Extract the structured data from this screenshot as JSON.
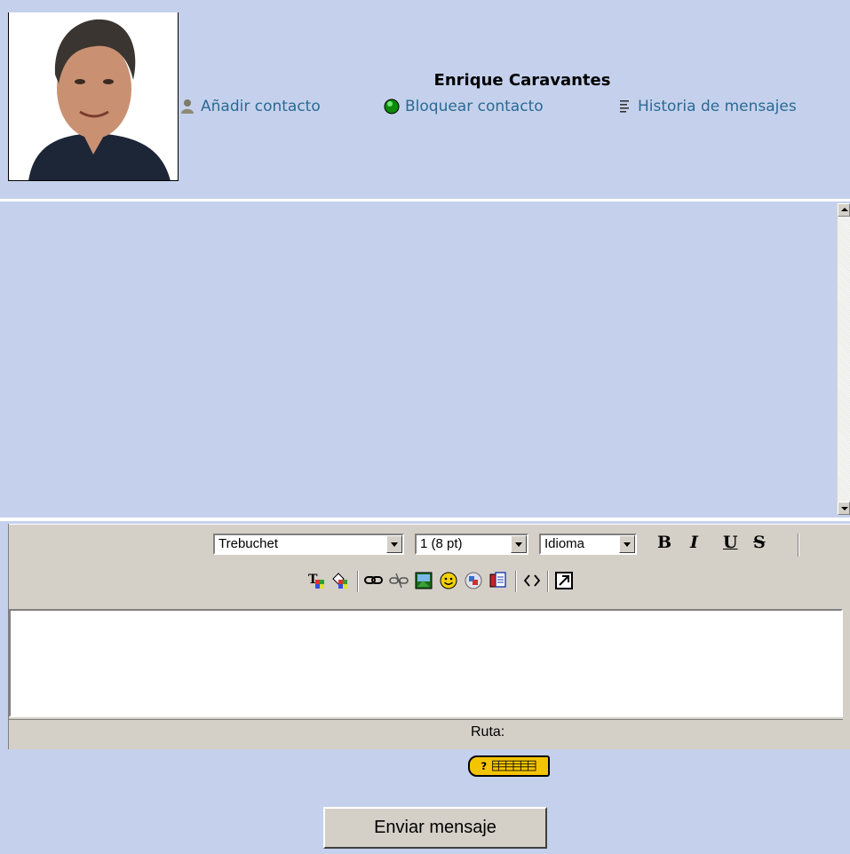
{
  "contact": {
    "name": "Enrique Caravantes",
    "actions": [
      {
        "label": "Añadir contacto",
        "icon": "person-icon"
      },
      {
        "label": "Bloquear contacto",
        "icon": "green-status-icon"
      },
      {
        "label": "Historia de mensajes",
        "icon": "history-list-icon"
      }
    ]
  },
  "editor": {
    "font_select": "Trebuchet",
    "size_select": "1 (8 pt)",
    "language_select": "Idioma",
    "format_buttons": [
      "B",
      "I",
      "U",
      "S"
    ],
    "path_label": "Ruta:"
  },
  "send_button": "Enviar mensaje",
  "colors": {
    "background": "#c5d1ec",
    "link": "#2a6a94",
    "toolbar": "#d4d0c8",
    "help_button": "#f5c400"
  }
}
